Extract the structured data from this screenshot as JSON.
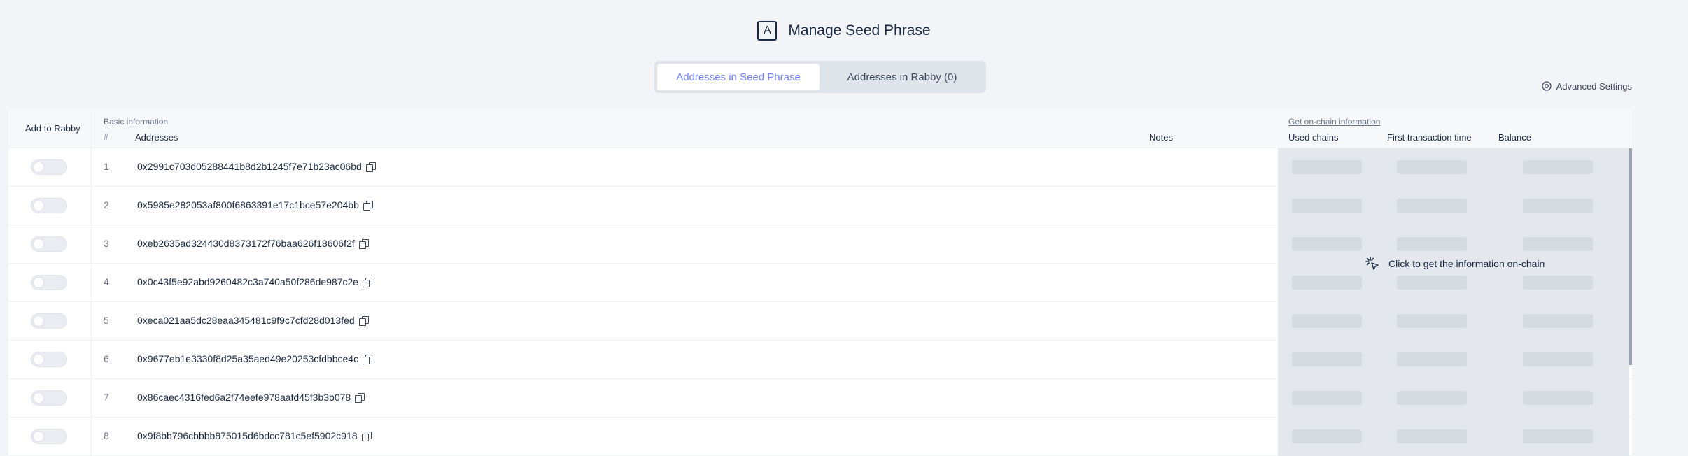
{
  "header": {
    "logo_letter": "A",
    "title": "Manage Seed Phrase"
  },
  "tabs": [
    {
      "label": "Addresses in Seed Phrase",
      "active": true
    },
    {
      "label": "Addresses in Rabby (0)",
      "active": false
    }
  ],
  "advanced_settings": {
    "label": "Advanced Settings",
    "icon": "gear-icon"
  },
  "table": {
    "col_add": "Add to Rabby",
    "group_basic": "Basic information",
    "col_index": "#",
    "col_addresses": "Addresses",
    "col_notes": "Notes",
    "group_onchain": "Get on-chain information",
    "col_used_chains": "Used chains",
    "col_first_tx": "First transaction time",
    "col_balance": "Balance",
    "onchain_prompt": "Click to get the information on-chain",
    "rows": [
      {
        "index": "1",
        "address": "0x2991c703d05288441b8d2b1245f7e71b23ac06bd"
      },
      {
        "index": "2",
        "address": "0x5985e282053af800f6863391e17c1bce57e204bb"
      },
      {
        "index": "3",
        "address": "0xeb2635ad324430d8373172f76baa626f18606f2f"
      },
      {
        "index": "4",
        "address": "0x0c43f5e92abd9260482c3a740a50f286de987c2e"
      },
      {
        "index": "5",
        "address": "0xeca021aa5dc28eaa345481c9f9c7cfd28d013fed"
      },
      {
        "index": "6",
        "address": "0x9677eb1e3330f8d25a35aed49e20253cfdbbce4c"
      },
      {
        "index": "7",
        "address": "0x86caec4316fed6a2f74eefe978aafd45f3b3b078"
      },
      {
        "index": "8",
        "address": "0x9f8bb796cbbbb875015d6bdcc781c5ef5902c918"
      }
    ]
  },
  "colors": {
    "accent": "#7084ff",
    "text": "#192945"
  }
}
